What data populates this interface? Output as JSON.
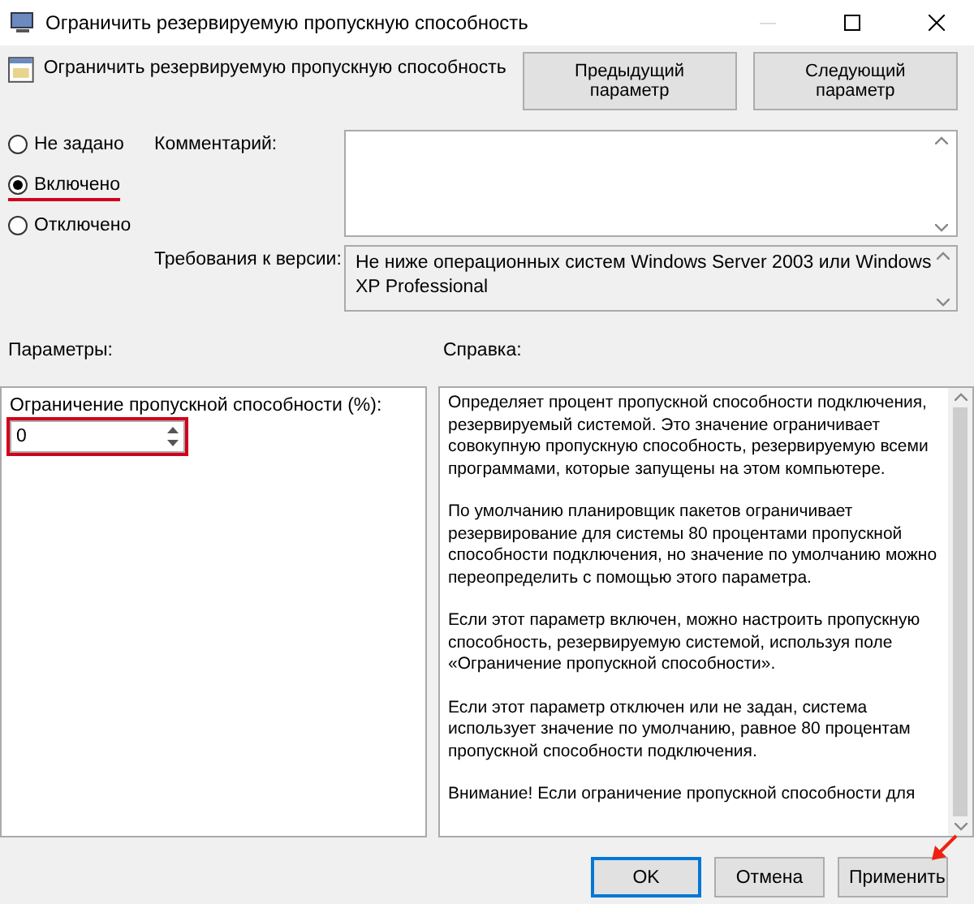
{
  "window": {
    "title": "Ограничить резервируемую пропускную способность"
  },
  "header": {
    "title": "Ограничить резервируемую пропускную способность",
    "buttons": [
      {
        "label": "Предыдущий параметр"
      },
      {
        "label": "Следующий параметр"
      }
    ]
  },
  "state_options": [
    {
      "label": "Не задано",
      "selected": false,
      "highlighted": false
    },
    {
      "label": "Включено",
      "selected": true,
      "highlighted": true
    },
    {
      "label": "Отключено",
      "selected": false,
      "highlighted": false
    }
  ],
  "comment": {
    "label": "Комментарий:"
  },
  "requirements": {
    "label": "Требования к версии:",
    "value": "Не ниже операционных систем Windows Server 2003 или Windows XP Professional"
  },
  "options_panel": {
    "label": "Параметры:",
    "spin": {
      "label": "Ограничение пропускной способности (%):",
      "value": "0",
      "highlighted": true
    }
  },
  "help_panel": {
    "label": "Справка:",
    "paragraphs": [
      "Определяет процент пропускной способности подключения, резервируемый системой. Это значение ограничивает совокупную пропускную способность, резервируемую всеми программами, которые запущены на этом компьютере.",
      "По умолчанию планировщик пакетов ограничивает резервирование для системы 80 процентами пропускной способности подключения, но значение по умолчанию можно переопределить с помощью этого параметра.",
      "Если этот параметр включен, можно настроить пропускную способность, резервируемую системой, используя поле «Ограничение пропускной способности».",
      "Если этот параметр отключен или не задан, система использует значение по умолчанию, равное 80 процентам пропускной способности подключения.",
      "Внимание! Если ограничение пропускной способности для"
    ]
  },
  "footer_buttons": [
    {
      "label": "OK",
      "kind": "default",
      "highlighted": false
    },
    {
      "label": "Отмена",
      "kind": "normal",
      "highlighted": false
    },
    {
      "label": "Применить",
      "kind": "normal",
      "highlighted": true
    }
  ]
}
